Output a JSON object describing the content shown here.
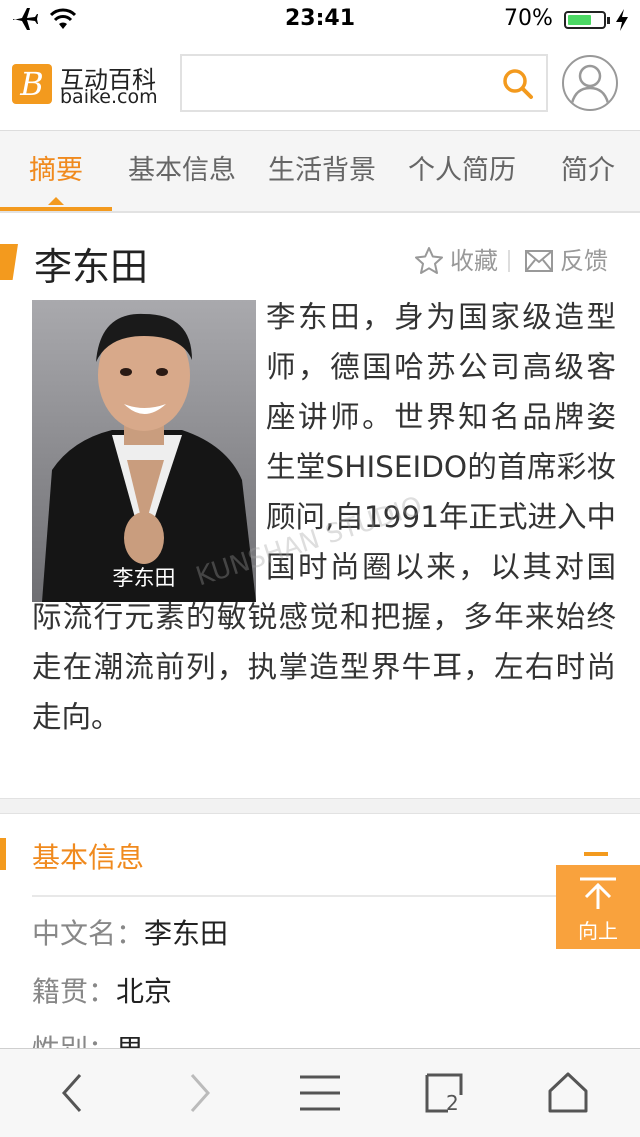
{
  "status_bar": {
    "time": "23:41",
    "battery": "70%",
    "battery_level": 0.7
  },
  "header": {
    "logo_cn": "互动百科",
    "logo_en": "baike.com",
    "logo_mark": "B",
    "search_placeholder": ""
  },
  "tabs": [
    {
      "label": "摘要",
      "active": true
    },
    {
      "label": "基本信息"
    },
    {
      "label": "生活背景"
    },
    {
      "label": "个人简历"
    },
    {
      "label": "简介"
    }
  ],
  "article": {
    "title": "李东田",
    "favorite_label": "收藏",
    "feedback_label": "反馈",
    "photo_caption": "李东田",
    "summary": "李东田，身为国家级造型师，德国哈苏公司高级客座讲师。世界知名品牌姿生堂SHISEIDO的首席彩妆顾问,自1991年正式进入中国时尚圈以来，以其对国际流行元素的敏锐感觉和把握，多年来始终走在潮流前列，执掌造型界牛耳，左右时尚走向。"
  },
  "basic_info": {
    "title": "基本信息",
    "rows": [
      {
        "key": "中文名：",
        "value": "李东田"
      },
      {
        "key": "籍贯：",
        "value": "北京"
      },
      {
        "key": "性别：",
        "value": "男"
      }
    ]
  },
  "back_to_top_label": "向上",
  "toolbar": {
    "tab_count": "2"
  },
  "colors": {
    "accent": "#f39a1e",
    "tab_active": "#f08a1e"
  }
}
